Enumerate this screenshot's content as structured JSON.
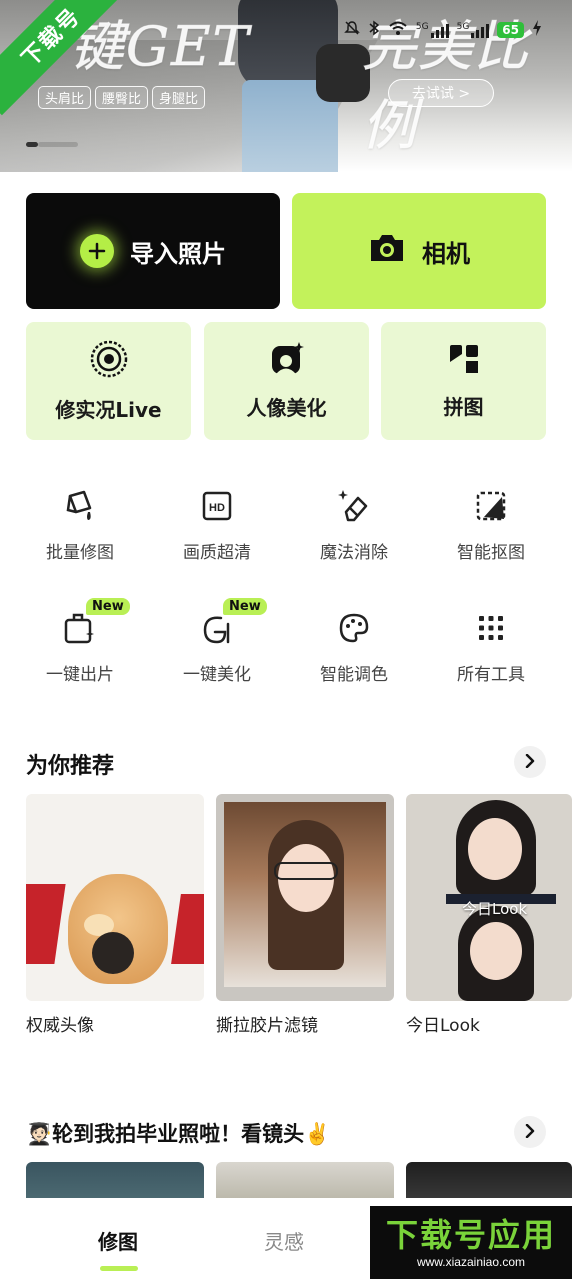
{
  "banner": {
    "headline_left": "键GET",
    "headline_right": "完美比例",
    "ratio_tags": [
      "头肩比",
      "腰臀比",
      "身腿比"
    ],
    "try_label": "去试试 >"
  },
  "watermark_corner": "下载号",
  "statusbar": {
    "sig1": "5G",
    "sig2": "5G",
    "battery": "65"
  },
  "actions": {
    "import_label": "导入照片",
    "camera_label": "相机"
  },
  "features": [
    {
      "label": "修实况Live",
      "icon": "live-photo-icon"
    },
    {
      "label": "人像美化",
      "icon": "portrait-icon"
    },
    {
      "label": "拼图",
      "icon": "collage-icon"
    }
  ],
  "tools": [
    {
      "label": "批量修图",
      "icon": "batch-edit-icon",
      "badge": ""
    },
    {
      "label": "画质超清",
      "icon": "hd-icon",
      "badge": ""
    },
    {
      "label": "魔法消除",
      "icon": "magic-eraser-icon",
      "badge": ""
    },
    {
      "label": "智能抠图",
      "icon": "cutout-icon",
      "badge": ""
    },
    {
      "label": "一键出片",
      "icon": "one-tap-photo-icon",
      "badge": "New"
    },
    {
      "label": "一键美化",
      "icon": "one-tap-beautify-icon",
      "badge": "New"
    },
    {
      "label": "智能调色",
      "icon": "palette-icon",
      "badge": ""
    },
    {
      "label": "所有工具",
      "icon": "grid-dots-icon",
      "badge": ""
    }
  ],
  "recommend": {
    "title": "为你推荐",
    "cards": [
      {
        "caption": "权威头像"
      },
      {
        "caption": "撕拉胶片滤镜"
      },
      {
        "caption": "今日Look",
        "overlay": "今日Look"
      }
    ]
  },
  "graduation": {
    "title": "🧑🏻‍🎓轮到我拍毕业照啦！看镜头✌️"
  },
  "bottom_tabs": {
    "edit": "修图",
    "inspiration": "灵感"
  },
  "watermark": {
    "main": "下载号应用",
    "url": "www.xiazainiao.com"
  },
  "colors": {
    "accent": "#c3f25b",
    "tile_bg": "#eaf8d3",
    "dark": "#0b0b0b"
  }
}
